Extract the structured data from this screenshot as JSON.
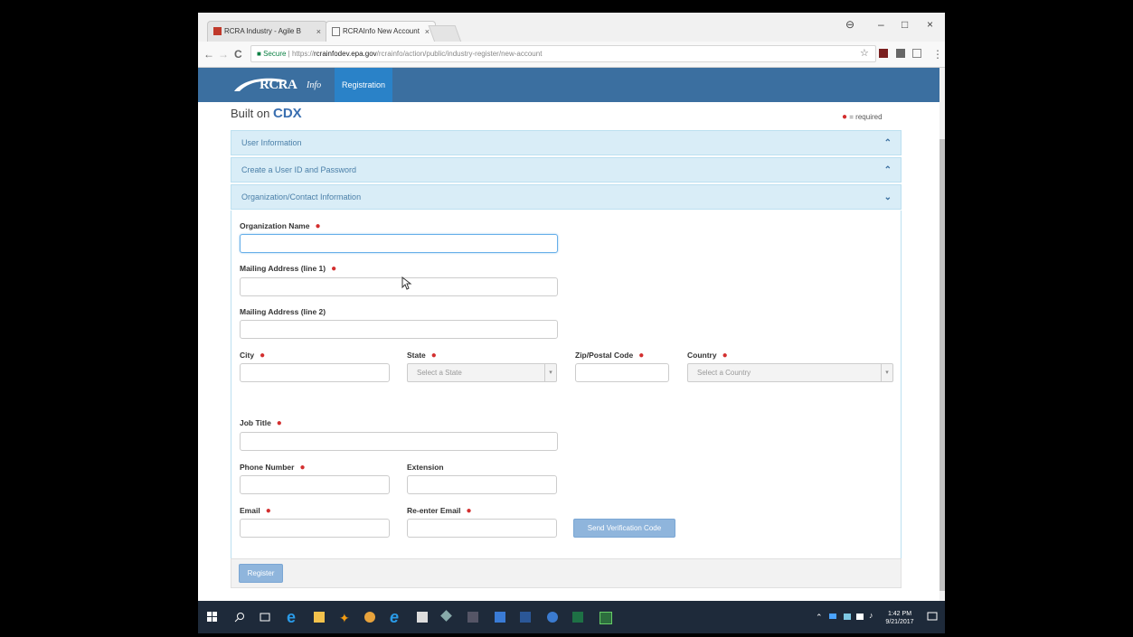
{
  "browser": {
    "tabs": [
      {
        "title": "RCRA Industry - Agile B",
        "close": "×"
      },
      {
        "title": "RCRAInfo New Account",
        "close": "×"
      }
    ],
    "window_controls": {
      "profile": "⊖",
      "minimize": "–",
      "maximize": "□",
      "close": "×"
    },
    "nav": {
      "back": "←",
      "forward": "→",
      "reload": "C"
    },
    "address": {
      "secure_label": "Secure",
      "separator": "|",
      "scheme": "https://",
      "host": "rcrainfodev.epa.gov",
      "path": "/rcrainfo/action/public/industry-register/new-account"
    },
    "star": "☆"
  },
  "site": {
    "logo_text": "RCRA",
    "logo_sub": "Info",
    "nav_tab": "Registration",
    "built_on_prefix": "Built on",
    "built_on_brand": "CDX",
    "required_note": "= required",
    "required_mark": "●"
  },
  "sections": [
    {
      "label": "User Information",
      "chevron": "⌃"
    },
    {
      "label": "Create a User ID and Password",
      "chevron": "⌃"
    },
    {
      "label": "Organization/Contact Information",
      "chevron": "⌄"
    }
  ],
  "form": {
    "org_name_label": "Organization Name",
    "mailing1_label": "Mailing Address (line 1)",
    "mailing2_label": "Mailing Address (line 2)",
    "city_label": "City",
    "state_label": "State",
    "state_placeholder": "Select a State",
    "zip_label": "Zip/Postal Code",
    "country_label": "Country",
    "country_placeholder": "Select a Country",
    "job_title_label": "Job Title",
    "phone_label": "Phone Number",
    "extension_label": "Extension",
    "email_label": "Email",
    "reenter_email_label": "Re-enter Email",
    "send_code_button": "Send Verification Code",
    "register_button": "Register"
  },
  "taskbar": {
    "time": "1:42 PM",
    "date": "9/21/2017"
  }
}
